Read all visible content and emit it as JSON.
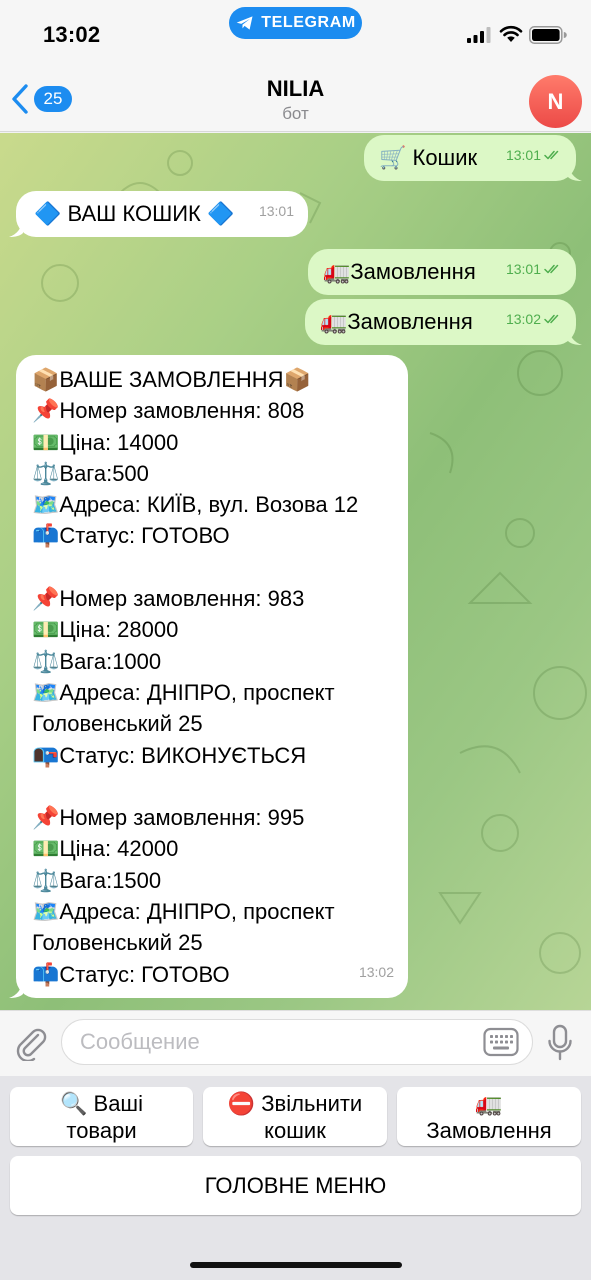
{
  "status_bar": {
    "time": "13:02",
    "telegram_label": "TELEGRAM"
  },
  "nav": {
    "back_count": "25",
    "title": "NILIA",
    "subtitle": "бот",
    "avatar_letter": "N"
  },
  "messages": [
    {
      "direction": "out",
      "text": "🛒 Кошик",
      "time": "13:01",
      "read": true
    },
    {
      "direction": "in",
      "text": "🔷 ВАШ КОШИК 🔷",
      "time": "13:01"
    },
    {
      "direction": "out",
      "text": "🚛Замовлення",
      "time": "13:01",
      "read": true
    },
    {
      "direction": "out",
      "text": "🚛Замовлення",
      "time": "13:02",
      "read": true
    },
    {
      "direction": "in",
      "time": "13:02",
      "lines": [
        "📦ВАШЕ ЗАМОВЛЕННЯ📦",
        "📌Номер замовлення: 808",
        "💵Ціна: 14000",
        "⚖️Вага:500",
        "🗺️Адреса: КИЇВ, вул. Возова 12",
        "📫Статус: ГОТОВО",
        "",
        "📌Номер замовлення: 983",
        "💵Ціна: 28000",
        "⚖️Вага:1000",
        "🗺️Адреса: ДНІПРО, проспект",
        "Головенський 25",
        "📭Статус: ВИКОНУЄТЬСЯ",
        "",
        "📌Номер замовлення: 995",
        "💵Ціна: 42000",
        "⚖️Вага:1500",
        "🗺️Адреса: ДНІПРО, проспект",
        "Головенський 25",
        "📫Статус: ГОТОВО"
      ]
    }
  ],
  "input": {
    "placeholder": "Сообщение",
    "value": ""
  },
  "keyboard": {
    "row1": [
      {
        "line1": "🔍 Ваші",
        "line2": "товари"
      },
      {
        "line1": "⛔ Звільнити",
        "line2": "кошик"
      },
      {
        "line1": "🚛",
        "line2": "Замовлення"
      }
    ],
    "main_menu": "ГОЛОВНЕ МЕНЮ"
  },
  "colors": {
    "accent": "#1c8cf0",
    "outgoing_bubble": "#dcf8c6",
    "incoming_bubble": "#ffffff",
    "read_check": "#4fae4e",
    "avatar": "#ec4a47"
  },
  "icons": {
    "telegram": "paper-plane-icon",
    "back": "chevron-left-icon",
    "attach": "paperclip-icon",
    "keyboard": "keyboard-icon",
    "mic": "microphone-icon",
    "read": "double-check-icon"
  }
}
